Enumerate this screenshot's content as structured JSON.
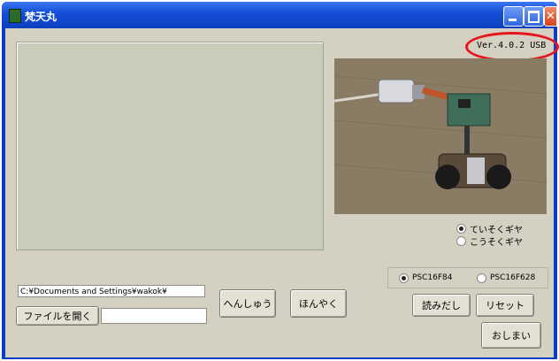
{
  "window": {
    "title": "梵天丸"
  },
  "version": {
    "text": "Ver.4.0.2 USB"
  },
  "gear": {
    "options": [
      {
        "label": "ていそくギヤ",
        "checked": true
      },
      {
        "label": "こうそくギヤ",
        "checked": false
      }
    ]
  },
  "chip": {
    "options": [
      {
        "label": "PSC16F84",
        "checked": true
      },
      {
        "label": "PSC16F628",
        "checked": false
      }
    ]
  },
  "file": {
    "path_value": "C:¥Documents and Settings¥wakok¥",
    "open_label": "ファイルを開く",
    "name_value": ""
  },
  "buttons": {
    "edit": "へんしゅう",
    "translate": "ほんやく",
    "read": "読みだし",
    "reset": "リセット",
    "exit": "おしまい"
  },
  "colors": {
    "titlebar": "#1650d8",
    "window_bg": "#d4d0c2",
    "display_bg": "#c7cdb9",
    "highlight": "#e8141c"
  },
  "icons": [
    "app-icon",
    "minimize-icon",
    "maximize-icon",
    "close-icon",
    "robot-photo"
  ]
}
